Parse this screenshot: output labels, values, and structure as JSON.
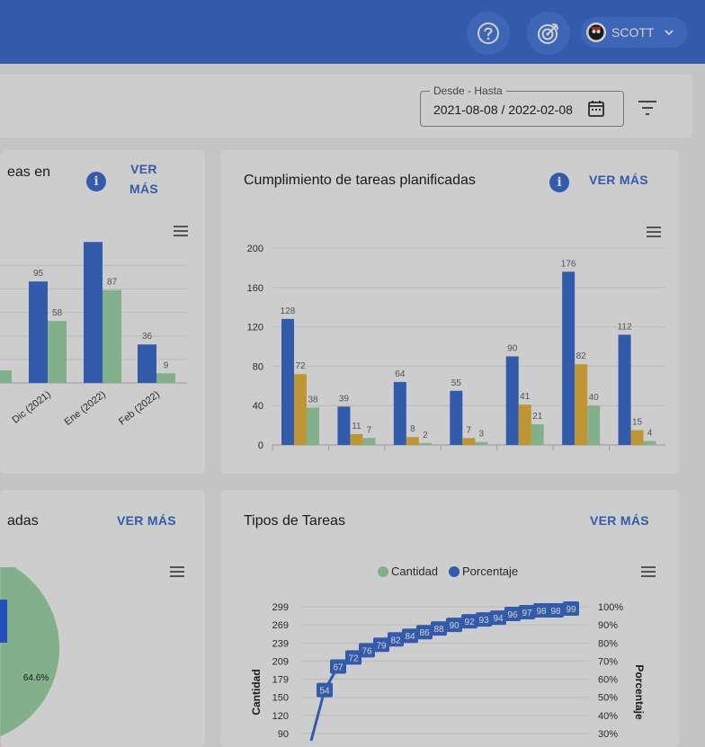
{
  "header": {
    "help_icon": "question-circle-icon",
    "target_icon": "target-icon",
    "user_name": "SCOTT"
  },
  "filter": {
    "date_label": "Desde - Hasta",
    "date_value": "2021-08-08 / 2022-02-08"
  },
  "cards": {
    "left_top": {
      "title": "eas en",
      "ver_mas_1": "VER",
      "ver_mas_2": "MÁS"
    },
    "right_top": {
      "title": "Cumplimiento de tareas planificadas",
      "ver_mas": "VER MÁS"
    },
    "left_bottom": {
      "title": "adas",
      "ver_mas": "VER MÁS",
      "pie_label": "64.6%"
    },
    "right_bottom": {
      "title": "Tipos de Tareas",
      "ver_mas": "VER MÁS"
    }
  },
  "chart_data": [
    {
      "type": "bar",
      "categories": [
        "Dic (2021)",
        "Ene (2022)",
        "Feb (2022)"
      ],
      "series": [
        {
          "values": [
            95,
            132,
            36
          ]
        },
        {
          "values": [
            58,
            87,
            9
          ]
        }
      ],
      "colors": [
        "#3f6fd1",
        "#9fd7a9"
      ]
    },
    {
      "type": "bar",
      "categories": [
        "",
        "",
        "",
        "",
        "",
        "",
        ""
      ],
      "series": [
        {
          "values": [
            128,
            39,
            64,
            55,
            90,
            176,
            112
          ]
        },
        {
          "values": [
            72,
            11,
            8,
            7,
            41,
            82,
            15
          ]
        },
        {
          "values": [
            38,
            7,
            2,
            3,
            21,
            40,
            4
          ]
        }
      ],
      "yticks": [
        0,
        40,
        80,
        120,
        160,
        200
      ],
      "ylim": [
        0,
        200
      ],
      "colors": [
        "#3f6fd1",
        "#e9b73f",
        "#9fd7a9"
      ]
    },
    {
      "type": "pie",
      "slices": [
        {
          "label": "64.6%",
          "value": 64.6
        }
      ],
      "colors": [
        "#9fd7a9"
      ]
    },
    {
      "type": "line",
      "legend": [
        "Cantidad",
        "Porcentaje"
      ],
      "ylabel": "Cantidad",
      "y2label": "Porcentaje",
      "yticks": [
        90,
        120,
        150,
        179,
        209,
        239,
        269,
        299
      ],
      "y2ticks": [
        "30%",
        "40%",
        "50%",
        "60%",
        "70%",
        "80%",
        "90%",
        "100%"
      ],
      "series": [
        {
          "name": "Porcentaje",
          "values": [
            54,
            67,
            72,
            76,
            79,
            82,
            84,
            86,
            88,
            90,
            92,
            93,
            94,
            96,
            97,
            98,
            98,
            99
          ]
        }
      ],
      "colors": [
        "#9fd7a9",
        "#3f6fd1"
      ]
    }
  ]
}
